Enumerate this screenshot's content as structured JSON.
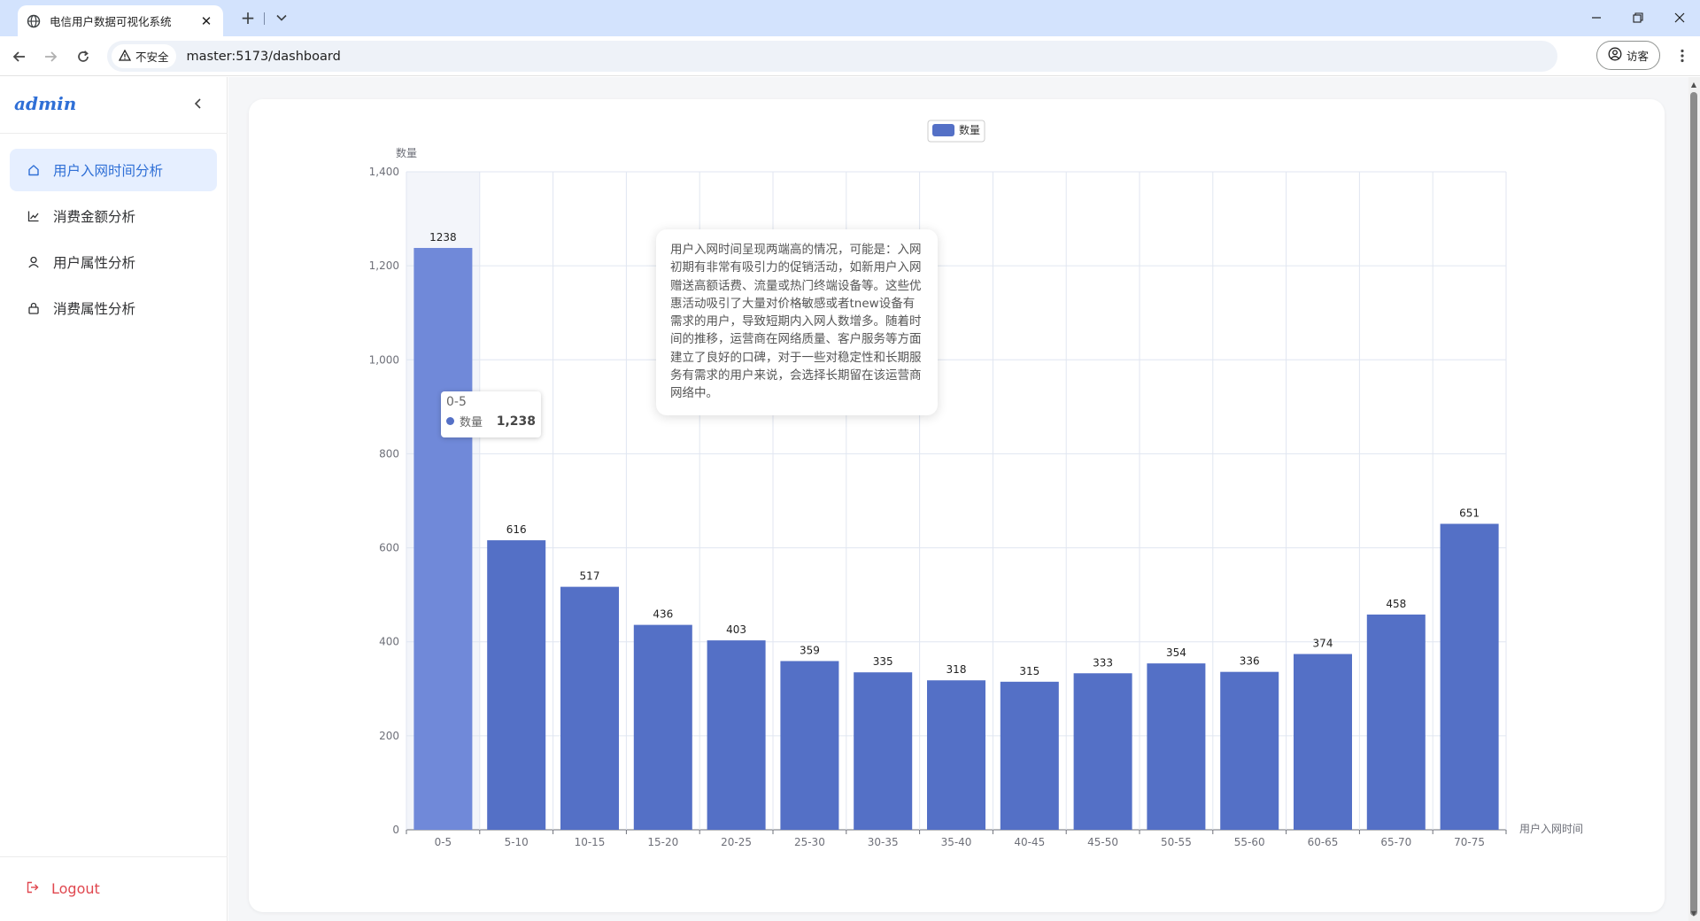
{
  "browser": {
    "tab_title": "电信用户数据可视化系统",
    "security_label": "不安全",
    "url": "master:5173/dashboard",
    "profile_label": "访客"
  },
  "sidebar": {
    "brand": "admin",
    "items": [
      {
        "label": "用户入网时间分析",
        "icon": "home-icon",
        "active": true
      },
      {
        "label": "消费金额分析",
        "icon": "line-chart-icon",
        "active": false
      },
      {
        "label": "用户属性分析",
        "icon": "user-icon",
        "active": false
      },
      {
        "label": "消费属性分析",
        "icon": "lock-icon",
        "active": false
      }
    ],
    "logout_label": "Logout"
  },
  "colors": {
    "accent": "#2f6fd6",
    "bar": "#5470c6",
    "bar_highlight": "#7089d9",
    "logout": "#e0474f"
  },
  "tooltip": {
    "title": "0-5",
    "series_name": "数量",
    "value": "1,238"
  },
  "note": {
    "text": "用户入网时间呈现两端高的情况，可能是：入网初期有非常有吸引力的促销活动，如新用户入网赠送高额话费、流量或热门终端设备等。这些优惠活动吸引了大量对价格敏感或者tnew设备有需求的用户，导致短期内入网人数增多。随着时间的推移，运营商在网络质量、客户服务等方面建立了良好的口碑，对于一些对稳定性和长期服务有需求的用户来说，会选择长期留在该运营商网络中。"
  },
  "chart_data": {
    "type": "bar",
    "categories": [
      "0-5",
      "5-10",
      "10-15",
      "15-20",
      "20-25",
      "25-30",
      "30-35",
      "35-40",
      "40-45",
      "45-50",
      "50-55",
      "55-60",
      "60-65",
      "65-70",
      "70-75"
    ],
    "series": [
      {
        "name": "数量",
        "values": [
          1238,
          616,
          517,
          436,
          403,
          359,
          335,
          318,
          315,
          333,
          354,
          336,
          374,
          458,
          651
        ]
      }
    ],
    "xlabel": "用户入网时间",
    "ylabel": "数量",
    "ylim": [
      0,
      1400
    ],
    "yticks": [
      "0",
      "200",
      "400",
      "600",
      "800",
      "1,000",
      "1,200",
      "1,400"
    ],
    "grid": true,
    "legend": "top-center",
    "highlighted_category": "0-5"
  }
}
